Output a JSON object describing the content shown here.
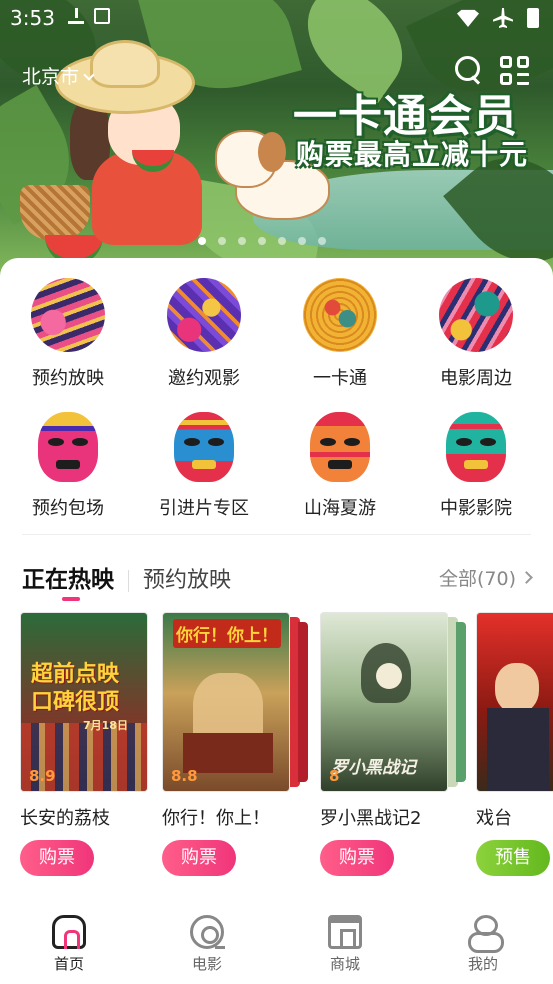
{
  "status_bar": {
    "time": "3:53"
  },
  "header": {
    "city": "北京市",
    "banner": {
      "headline": "一卡通会员",
      "subline": "购票最高立减十元",
      "slide_count": 7,
      "active_slide": 1
    }
  },
  "menu": {
    "items": [
      {
        "label": "预约放映",
        "icon": "screening-art-icon"
      },
      {
        "label": "邀约观影",
        "icon": "invite-art-icon"
      },
      {
        "label": "一卡通",
        "icon": "card-art-icon"
      },
      {
        "label": "电影周边",
        "icon": "merch-art-icon"
      },
      {
        "label": "预约包场",
        "icon": "mask-pink-icon"
      },
      {
        "label": "引进片专区",
        "icon": "mask-blue-icon"
      },
      {
        "label": "山海夏游",
        "icon": "mask-orange-icon"
      },
      {
        "label": "中影影院",
        "icon": "mask-teal-icon"
      }
    ]
  },
  "tabs": {
    "active": "正在热映",
    "inactive": "预约放映",
    "more": "全部(70)"
  },
  "movies": [
    {
      "title": "长安的荔枝",
      "rating": "8.9",
      "poster_text": "超前点映 口碑很顶",
      "poster_date": "7月18日",
      "button": "购票",
      "button_type": "buy"
    },
    {
      "title": "你行！你上！",
      "rating": "8.8",
      "poster_text": "你行！你上！",
      "poster_date": "",
      "button": "购票",
      "button_type": "buy"
    },
    {
      "title": "罗小黑战记2",
      "rating": "8",
      "poster_text": "罗小黑战记",
      "poster_date": "",
      "button": "购票",
      "button_type": "buy"
    },
    {
      "title": "戏台",
      "rating": "",
      "poster_text": "",
      "poster_date": "",
      "button": "预售",
      "button_type": "presale"
    }
  ],
  "bottom_nav": [
    {
      "label": "首页",
      "icon": "home-icon",
      "active": true
    },
    {
      "label": "电影",
      "icon": "film-icon",
      "active": false
    },
    {
      "label": "商城",
      "icon": "shop-icon",
      "active": false
    },
    {
      "label": "我的",
      "icon": "user-icon",
      "active": false
    }
  ],
  "colors": {
    "accent": "#f0357a",
    "presale": "#7ac72d",
    "rating": "#ff9a3c"
  }
}
